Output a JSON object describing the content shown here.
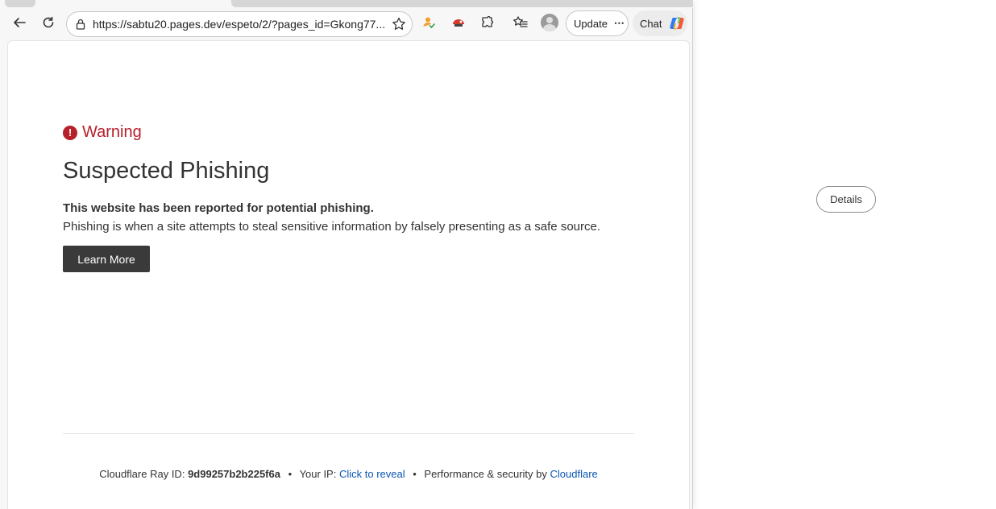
{
  "browser": {
    "url": "https://sabtu20.pages.dev/espeto/2/?pages_id=Gkong77...",
    "update_label": "Update",
    "update_more": "⋯",
    "chat_label": "Chat"
  },
  "page": {
    "warning_label": "Warning",
    "warning_icon": "!",
    "headline": "Suspected Phishing",
    "lead": "This website has been reported for potential phishing.",
    "description": "Phishing is when a site attempts to steal sensitive information by falsely presenting as a safe source.",
    "learn_more": "Learn More"
  },
  "footer": {
    "ray_label": "Cloudflare Ray ID:",
    "ray_id": "9d99257b2b225f6a",
    "separator": "•",
    "ip_label": "Your IP:",
    "ip_link": "Click to reveal",
    "perf_label": "Performance & security by",
    "cloudflare_link": "Cloudflare"
  },
  "side": {
    "details_label": "Details"
  },
  "colors": {
    "warning": "#b6202a",
    "link": "#0b56b3",
    "button_dark": "#3a3a3a"
  }
}
